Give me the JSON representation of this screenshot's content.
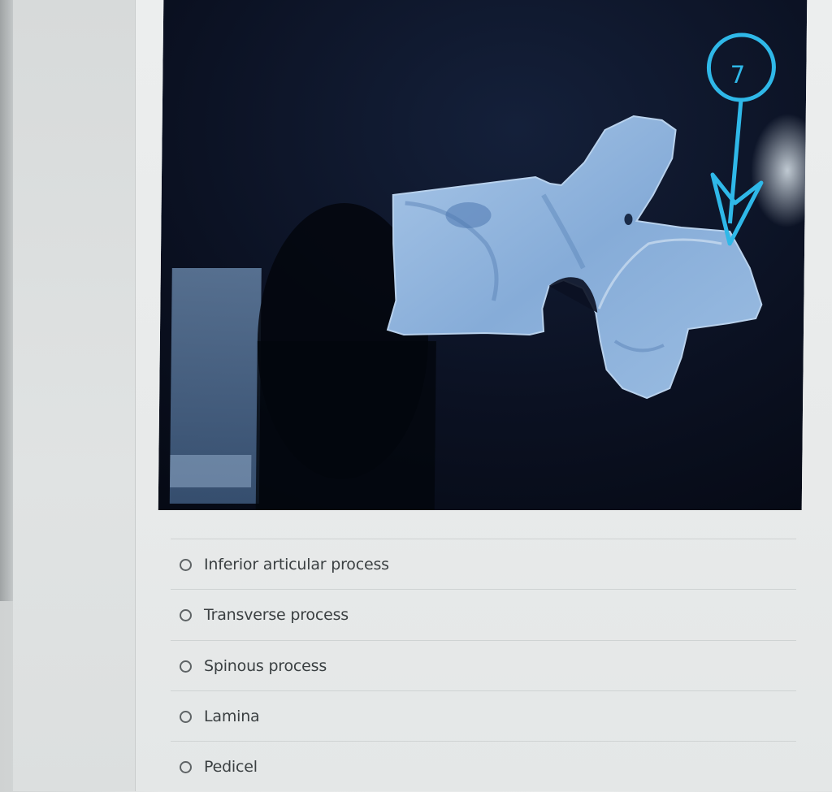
{
  "figure": {
    "number_label": "7",
    "accent_color": "#2fb8e8",
    "background_color": "#0c1326",
    "bone_color": "#8fb4dc"
  },
  "question": {
    "options": [
      {
        "label": "Inferior articular process",
        "selected": false
      },
      {
        "label": "Transverse process",
        "selected": false
      },
      {
        "label": "Spinous process",
        "selected": false
      },
      {
        "label": "Lamina",
        "selected": false
      },
      {
        "label": "Pedicel",
        "selected": false
      }
    ]
  }
}
